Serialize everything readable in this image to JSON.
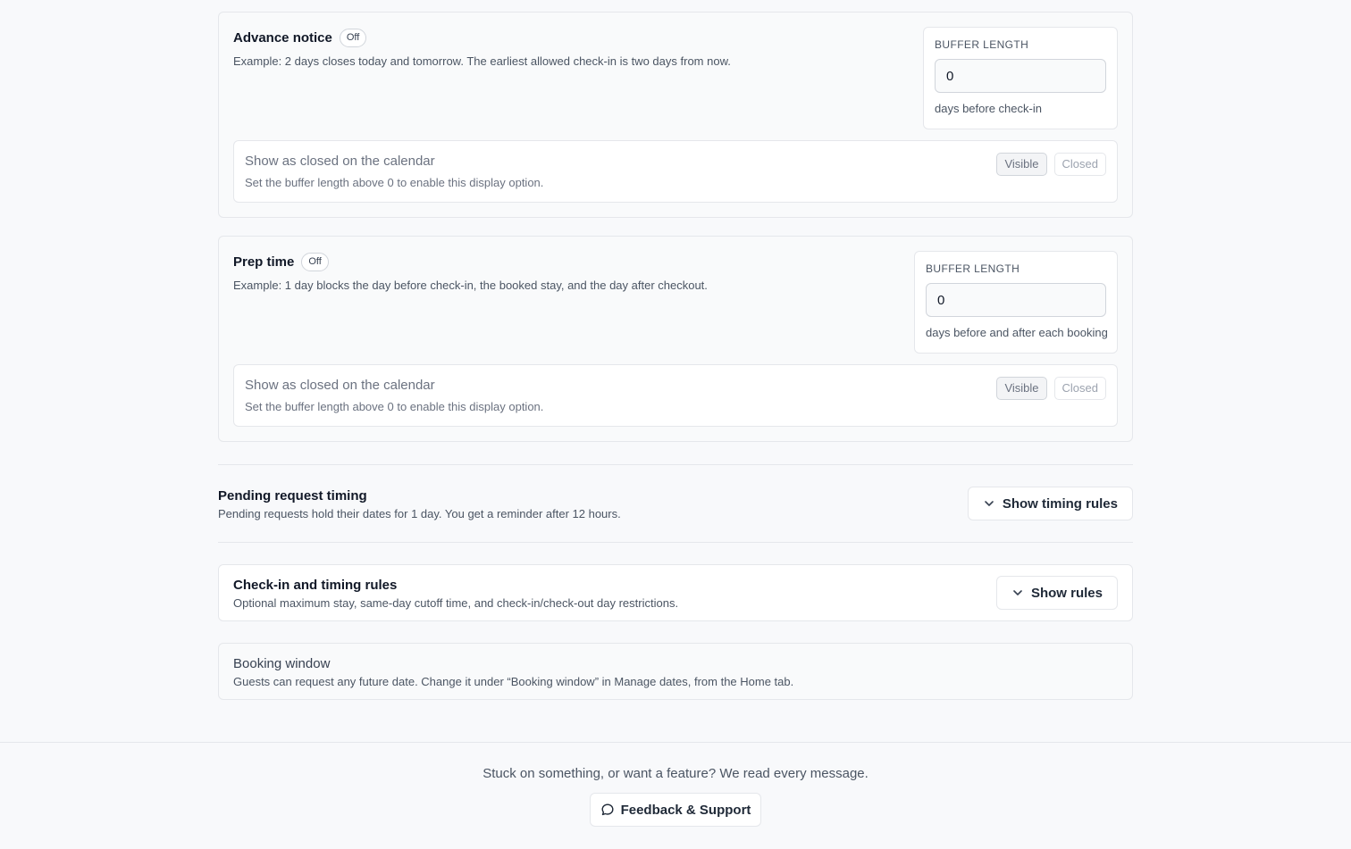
{
  "advance_notice": {
    "title": "Advance notice",
    "status": "Off",
    "description": "Example: 2 days closes today and tomorrow. The earliest allowed check-in is two days from now.",
    "buffer_label": "BUFFER LENGTH",
    "buffer_value": "0",
    "buffer_unit": "days before check-in",
    "display_title": "Show as closed on the calendar",
    "display_desc": "Set the buffer length above 0 to enable this display option.",
    "visible_label": "Visible",
    "closed_label": "Closed"
  },
  "prep_time": {
    "title": "Prep time",
    "status": "Off",
    "description": "Example: 1 day blocks the day before check-in, the booked stay, and the day after checkout.",
    "buffer_label": "BUFFER LENGTH",
    "buffer_value": "0",
    "buffer_unit": "days before and after each booking",
    "display_title": "Show as closed on the calendar",
    "display_desc": "Set the buffer length above 0 to enable this display option.",
    "visible_label": "Visible",
    "closed_label": "Closed"
  },
  "pending": {
    "title": "Pending request timing",
    "description": "Pending requests hold their dates for 1 day. You get a reminder after 12 hours.",
    "button_label": "Show timing rules"
  },
  "checkin": {
    "title": "Check-in and timing rules",
    "description": "Optional maximum stay, same-day cutoff time, and check-in/check-out day restrictions.",
    "button_label": "Show rules"
  },
  "booking_window": {
    "title": "Booking window",
    "description": "Guests can request any future date. Change it under “Booking window” in Manage dates, from the Home tab."
  },
  "footer": {
    "text": "Stuck on something, or want a feature? We read every message.",
    "button_label": "Feedback & Support"
  },
  "icons": {
    "expand": "chevron-down-icon",
    "feedback": "chat-bubble-icon"
  }
}
